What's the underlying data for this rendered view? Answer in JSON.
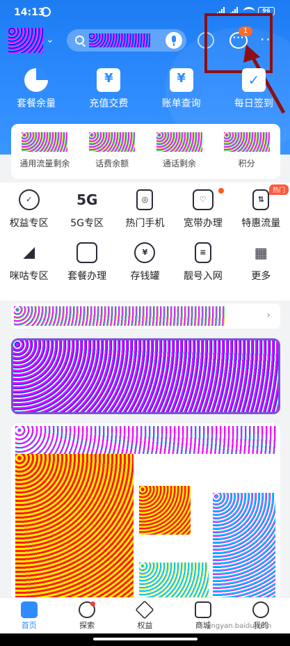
{
  "status_bar": {
    "time": "14:13",
    "battery": "96"
  },
  "notification_badge": "1",
  "quick_menu": [
    {
      "label": "套餐余量",
      "icon": "pie-chart-icon"
    },
    {
      "label": "充值交费",
      "icon": "yen-receipt-icon",
      "glyph": "¥"
    },
    {
      "label": "账单查询",
      "icon": "yen-bill-icon",
      "glyph": "¥"
    },
    {
      "label": "每日签到",
      "icon": "checkin-icon",
      "glyph": "✓"
    }
  ],
  "balance_card": [
    {
      "label": "通用流量剩余"
    },
    {
      "label": "话费余额"
    },
    {
      "label": "通话剩余"
    },
    {
      "label": "积分"
    }
  ],
  "services": [
    {
      "label": "权益专区",
      "icon": "medal-icon"
    },
    {
      "label": "5G专区",
      "icon": "5g-icon",
      "glyph": "5G"
    },
    {
      "label": "热门手机",
      "icon": "phone-icon"
    },
    {
      "label": "宽带办理",
      "icon": "home-broadband-icon"
    },
    {
      "label": "特惠流量",
      "icon": "data-transfer-icon",
      "tag": "热门"
    },
    {
      "label": "咪咕专区",
      "icon": "migu-icon"
    },
    {
      "label": "套餐办理",
      "icon": "bag-icon"
    },
    {
      "label": "存钱罐",
      "icon": "piggy-bank-icon",
      "glyph": "¥"
    },
    {
      "label": "靓号入网",
      "icon": "sim-card-icon"
    },
    {
      "label": "更多",
      "icon": "grid-more-icon"
    }
  ],
  "bottom_nav": [
    {
      "label": "首页",
      "icon": "home-icon"
    },
    {
      "label": "探索",
      "icon": "compass-icon"
    },
    {
      "label": "权益",
      "icon": "diamond-icon"
    },
    {
      "label": "商城",
      "icon": "shopping-bag-icon"
    },
    {
      "label": "我的",
      "icon": "user-icon"
    }
  ],
  "watermark": "jingyan.baidu.com",
  "colors": {
    "primary": "#2e8cff",
    "annotation": "#8b0f14",
    "badge": "#ff6b2c"
  }
}
